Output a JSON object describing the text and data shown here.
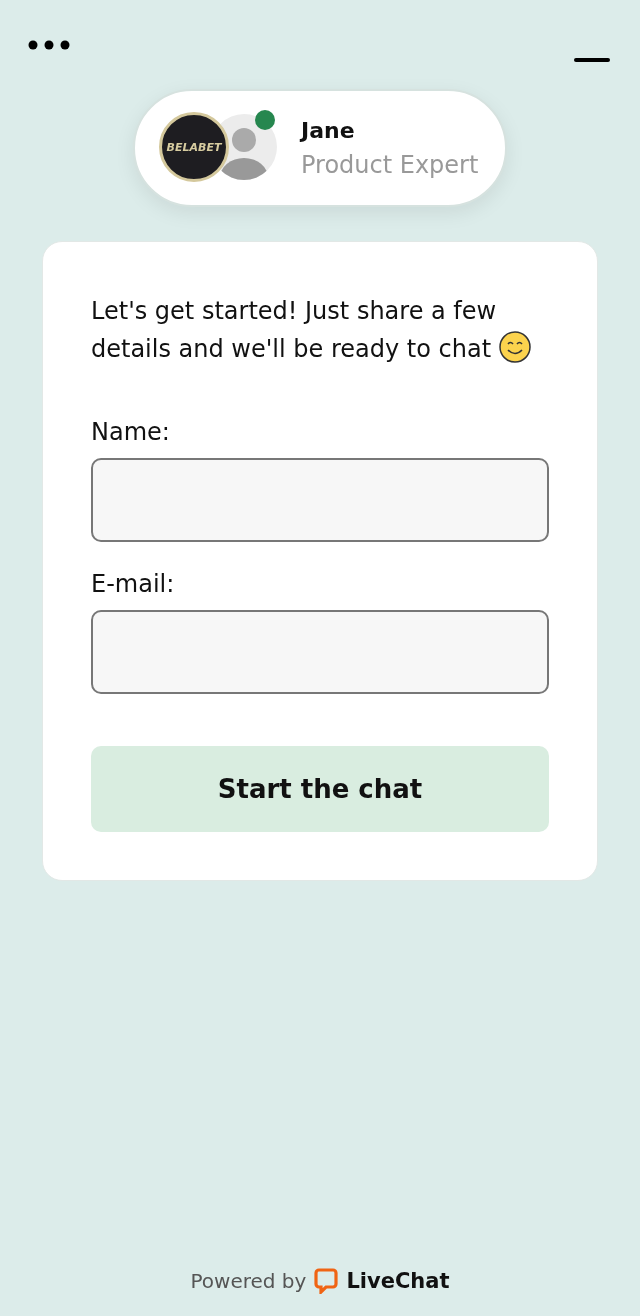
{
  "agent": {
    "brand": "BELABET",
    "name": "Jane",
    "role": "Product Expert",
    "online": true
  },
  "form": {
    "intro": "Let's get started! Just share a few details and we'll be ready to chat",
    "fields": [
      {
        "label": "Name:"
      },
      {
        "label": "E-mail:"
      }
    ],
    "submit": "Start the chat"
  },
  "footer": {
    "prefix": "Powered by",
    "brand": "LiveChat"
  }
}
